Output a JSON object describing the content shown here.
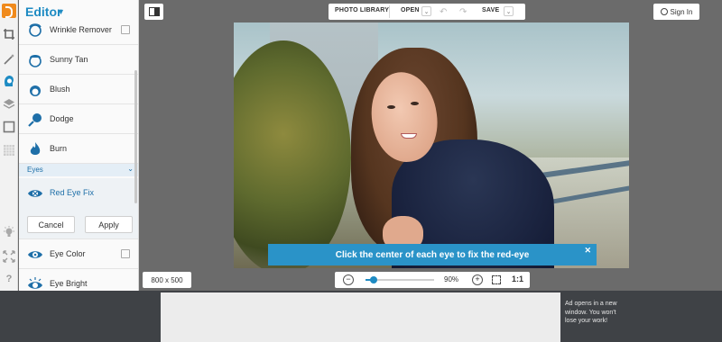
{
  "app": {
    "editor_title": "Editor"
  },
  "rail": {
    "icons": [
      "logo-icon",
      "crop-icon",
      "magic-wand-icon",
      "face-icon",
      "layers-icon",
      "frame-icon",
      "texture-icon",
      "light-bulb-icon",
      "expand-icon",
      "help-icon"
    ]
  },
  "panel": {
    "tools_top": [
      {
        "label": "Wrinkle Remover",
        "icon": "wrinkle-icon",
        "has_box": true
      },
      {
        "label": "Sunny Tan",
        "icon": "sunny-tan-icon",
        "has_box": false
      },
      {
        "label": "Blush",
        "icon": "blush-icon",
        "has_box": false
      },
      {
        "label": "Dodge",
        "icon": "dodge-icon",
        "has_box": false
      },
      {
        "label": "Burn",
        "icon": "burn-icon",
        "has_box": false
      }
    ],
    "section_label": "Eyes",
    "active_tool": {
      "label": "Red Eye Fix",
      "icon": "red-eye-icon"
    },
    "cancel_label": "Cancel",
    "apply_label": "Apply",
    "tools_bottom": [
      {
        "label": "Eye Color",
        "icon": "eye-color-icon",
        "has_box": true
      },
      {
        "label": "Eye Bright",
        "icon": "eye-bright-icon",
        "has_box": false
      }
    ]
  },
  "toolbar": {
    "photo_library": "PHOTO LIBRARY",
    "open": "OPEN",
    "save": "SAVE",
    "sign_in": "Sign In"
  },
  "banner": {
    "text": "Click the center of each eye to fix the red-eye"
  },
  "footer": {
    "image_size": "800 x 500",
    "zoom_level": "90%",
    "zoom_fraction": 0.12,
    "actual_size": "1:1"
  },
  "ad": {
    "note": "Ad opens in a new window. You won't lose your work!"
  },
  "colors": {
    "accent": "#1e8bc3",
    "banner": "#2a93c8",
    "workspace": "#6b6b6b",
    "ad_bar": "#3f4246"
  }
}
